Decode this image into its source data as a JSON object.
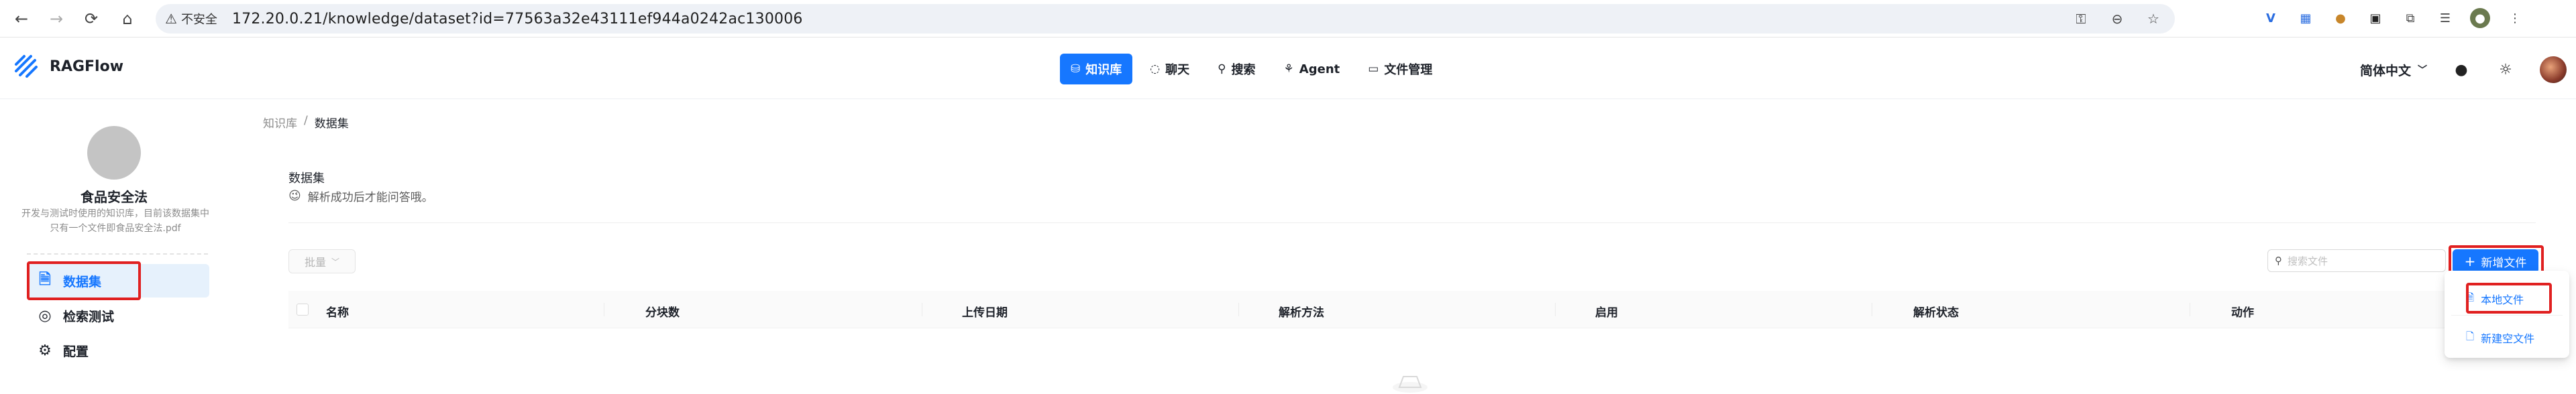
{
  "browser": {
    "insecure_label": "不安全",
    "url": "172.20.0.21/knowledge/dataset?id=77563a32e43111ef944a0242ac130006"
  },
  "app": {
    "name": "RAGFlow",
    "nav": [
      {
        "label": "知识库",
        "icon": "database-icon",
        "active": true
      },
      {
        "label": "聊天",
        "icon": "chat-icon"
      },
      {
        "label": "搜索",
        "icon": "search-icon"
      },
      {
        "label": "Agent",
        "icon": "agent-icon"
      },
      {
        "label": "文件管理",
        "icon": "folder-icon"
      }
    ],
    "language": "简体中文",
    "accent": "#1677ff",
    "highlight": "#e02020"
  },
  "sidebar": {
    "kb_name": "食品安全法",
    "kb_desc_line1": "开发与测试时使用的知识库，目前该数据集中",
    "kb_desc_line2": "只有一个文件即食品安全法.pdf",
    "items": [
      {
        "label": "数据集",
        "icon": "file-icon"
      },
      {
        "label": "检索测试",
        "icon": "target-icon"
      },
      {
        "label": "配置",
        "icon": "gear-icon"
      }
    ]
  },
  "main": {
    "breadcrumb": [
      "知识库",
      "/",
      "数据集"
    ],
    "title": "数据集",
    "tip": "解析成功后才能问答哦。",
    "bulk_label": "批量",
    "search_placeholder": "搜索文件",
    "add_label": "新增文件",
    "columns": [
      "名称",
      "分块数",
      "上传日期",
      "解析方法",
      "启用",
      "解析状态",
      "动作"
    ],
    "dropdown": [
      "本地文件",
      "新建空文件"
    ]
  }
}
